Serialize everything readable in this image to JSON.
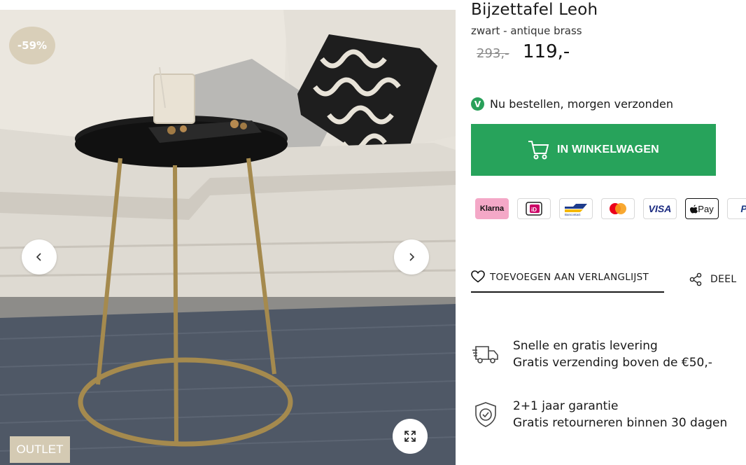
{
  "gallery": {
    "discount_badge": "-59%",
    "tag": "OUTLET"
  },
  "product": {
    "title": "Bijzettafel Leoh",
    "variant": "zwart - antique brass",
    "old_price": "293,-",
    "price": "119,-"
  },
  "stock": {
    "icon": "V",
    "text": "Nu bestellen, morgen verzonden"
  },
  "cart": {
    "label": "IN WINKELWAGEN",
    "color": "#27a35b"
  },
  "payments": {
    "klarna": "Klarna",
    "ideal": "iD",
    "bancontact": "Bancontact",
    "mastercard": "mastercard",
    "visa": "VISA",
    "applepay": "Pay",
    "paypal": "P"
  },
  "actions": {
    "wishlist": "TOEVOEGEN AAN VERLANGLIJST",
    "share": "DEEL"
  },
  "usps": [
    {
      "title": "Snelle en gratis levering",
      "subtitle": "Gratis verzending boven de €50,-"
    },
    {
      "title": "2+1 jaar garantie",
      "subtitle": "Gratis retourneren binnen 30 dagen"
    }
  ]
}
